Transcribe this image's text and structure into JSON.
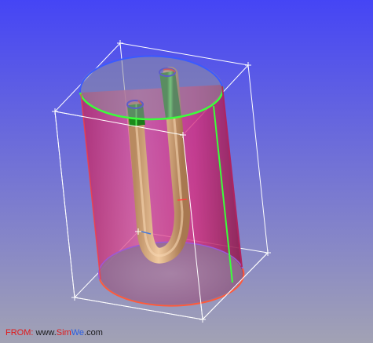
{
  "viewport": {
    "background_top": "#4545f5",
    "background_bottom": "#a2a2b4"
  },
  "model": {
    "cylinder_color": "#e0327f",
    "cylinder_edge_color": "#ff3b3b",
    "top_face_color": "#8f8f9c",
    "top_rim_color": "#3bff3b",
    "bottom_rim_color": "#ff5a3b",
    "pipe_color": "#d6a77a",
    "pipe_inlet_color": "#2fc02f",
    "inlet_ring_color": "#ff2020",
    "outlet_ring_color": "#2020ff",
    "bounding_box_color": "#ffffff"
  },
  "watermark": {
    "prefix": "FROM:",
    "www": " www.",
    "sim": "Sim",
    "we": "We",
    "com": ".com"
  }
}
